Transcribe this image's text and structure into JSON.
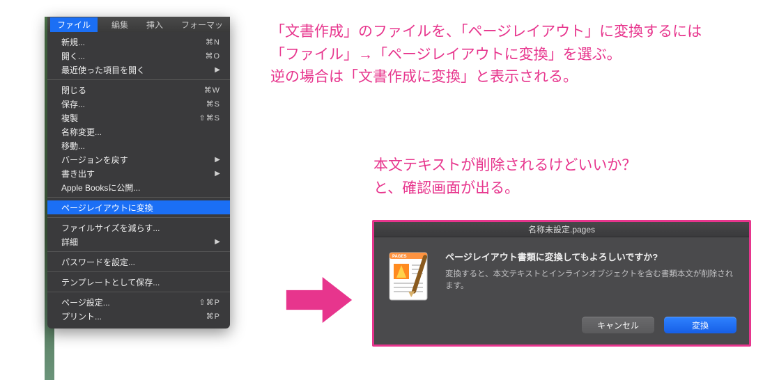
{
  "menubar": {
    "active": "ファイル",
    "items": [
      "編集",
      "挿入",
      "フォーマッ"
    ]
  },
  "menu": {
    "new": "新規...",
    "new_kbd": "⌘N",
    "open": "開く...",
    "open_kbd": "⌘O",
    "recent": "最近使った項目を開く",
    "close": "閉じる",
    "close_kbd": "⌘W",
    "save": "保存...",
    "save_kbd": "⌘S",
    "duplicate": "複製",
    "duplicate_kbd": "⇧⌘S",
    "rename": "名称変更...",
    "move": "移動...",
    "revert": "バージョンを戻す",
    "export": "書き出す",
    "applebooks": "Apple Booksに公開...",
    "convert": "ページレイアウトに変換",
    "reduce": "ファイルサイズを減らす...",
    "advanced": "詳細",
    "password": "パスワードを設定...",
    "template": "テンプレートとして保存...",
    "pagesetup": "ページ設定...",
    "pagesetup_kbd": "⇧⌘P",
    "print": "プリント...",
    "print_kbd": "⌘P"
  },
  "instruction": {
    "line1": "「文書作成」のファイルを、「ページレイアウト」に変換するには",
    "line2": "「ファイル」→「ページレイアウトに変換」を選ぶ。",
    "line3": "逆の場合は「文書作成に変換」と表示される。"
  },
  "dialog_caption": {
    "line1": "本文テキストが削除されるけどいいか？",
    "line2": "と、確認画面が出る。"
  },
  "dialog": {
    "title": "名称未設定.pages",
    "heading": "ページレイアウト書類に変換してもよろしいですか?",
    "desc": "変換すると、本文テキストとインラインオブジェクトを含む書類本文が削除されます。",
    "cancel": "キャンセル",
    "convert": "変換"
  }
}
